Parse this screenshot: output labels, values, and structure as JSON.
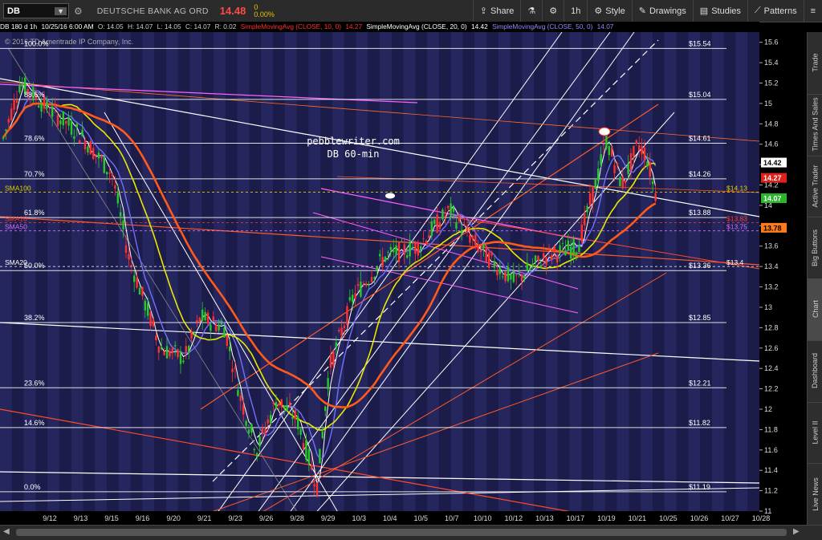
{
  "toolbar": {
    "symbol": "DB",
    "symbol_caret": "▼",
    "company": "DEUTSCHE BANK AG ORD",
    "price": "14.48",
    "change": "0",
    "change_pct": "0.00%",
    "share": "Share",
    "interval": "1h",
    "style": "Style",
    "drawings": "Drawings",
    "studies": "Studies",
    "patterns": "Patterns"
  },
  "studybar": {
    "symbol": "DB 180 d 1h",
    "date": "10/25/16 6:00 AM",
    "open": "O: 14.05",
    "high": "H: 14.07",
    "low": "L: 14.05",
    "close": "C: 14.07",
    "range": "R: 0.02",
    "sma10": "SimpleMovingAvg (CLOSE, 10, 0)",
    "sma10_val": "14.27",
    "sma20": "SimpleMovingAvg (CLOSE, 20, 0)",
    "sma20_val": "14.42",
    "sma50": "SimpleMovingAvg (CLOSE, 50, 0)",
    "sma50_val": "14.07"
  },
  "chart_data": {
    "type": "line",
    "copyright": "© 2016 TD Ameritrade IP Company, Inc.",
    "watermark_line1": "pebblewriter.com",
    "watermark_line2": "DB 60-min",
    "ylim": [
      11.0,
      15.7
    ],
    "yticks": [
      11,
      11.2,
      11.4,
      11.6,
      11.8,
      12,
      12.2,
      12.4,
      12.6,
      12.8,
      13,
      13.2,
      13.4,
      13.6,
      13.8,
      14,
      14.2,
      14.4,
      14.6,
      14.8,
      15,
      15.2,
      15.4,
      15.6
    ],
    "xlabels": [
      "9/12",
      "9/13",
      "9/15",
      "9/16",
      "9/20",
      "9/21",
      "9/23",
      "9/26",
      "9/28",
      "9/29",
      "10/3",
      "10/4",
      "10/5",
      "10/7",
      "10/10",
      "10/12",
      "10/13",
      "10/17",
      "10/19",
      "10/21",
      "10/25",
      "10/26",
      "10/27",
      "10/28"
    ],
    "fib_levels": [
      {
        "pct": "100.0%",
        "price": 15.54,
        "label": "$15.54"
      },
      {
        "pct": "88.6%",
        "price": 15.04,
        "label": "$15.04"
      },
      {
        "pct": "78.6%",
        "price": 14.61,
        "label": "$14.61"
      },
      {
        "pct": "70.7%",
        "price": 14.26,
        "label": "$14.26"
      },
      {
        "pct": "61.8%",
        "price": 13.88,
        "label": "$13.88"
      },
      {
        "pct": "50.0%",
        "price": 13.36,
        "label": "$13.36"
      },
      {
        "pct": "38.2%",
        "price": 12.85,
        "label": "$12.85"
      },
      {
        "pct": "23.6%",
        "price": 12.21,
        "label": "$12.21"
      },
      {
        "pct": "14.6%",
        "price": 11.82,
        "label": "$11.82"
      },
      {
        "pct": "0.0%",
        "price": 11.19,
        "label": "$11.19"
      }
    ],
    "sma_labels": [
      {
        "name": "SMA100",
        "price": 14.13,
        "value_label": "$14.13",
        "color": "#e0d000"
      },
      {
        "name": "SMA10",
        "price": 13.83,
        "value_label": "$13.83",
        "color": "#ff3a2a"
      },
      {
        "name": "SMA50",
        "price": 13.75,
        "value_label": "$13.75",
        "color": "#d070ff"
      },
      {
        "name": "SMA20",
        "price": 13.4,
        "value_label": "$13.4",
        "color": "#ffffff"
      }
    ],
    "price_badges": [
      {
        "label": "14.42",
        "price": 14.42,
        "bg": "#ffffff",
        "fg": "#000000"
      },
      {
        "label": "14.27",
        "price": 14.27,
        "bg": "#e0201a",
        "fg": "#ffffff"
      },
      {
        "label": "14.07",
        "price": 14.07,
        "bg": "#2ab52a",
        "fg": "#ffffff"
      },
      {
        "label": "13.78",
        "price": 13.78,
        "bg": "#ff7a1a",
        "fg": "#000000"
      }
    ],
    "series": [
      {
        "name": "DB",
        "kind": "candles",
        "color_up": "#28c828",
        "color_down": "#ff3030"
      },
      {
        "name": "SMA10",
        "color": "#ffffff"
      },
      {
        "name": "SMA20",
        "color": "#7070ff"
      },
      {
        "name": "SMA50",
        "color": "#e8e800"
      },
      {
        "name": "SMA100",
        "color": "#ff5a1a"
      }
    ],
    "colors": {
      "stripe_a": "#1c1c4a",
      "stripe_b": "#26265e",
      "bg": "#000000"
    }
  },
  "right_tabs": [
    "Trade",
    "Times And Sales",
    "Active Trader",
    "Big Buttons",
    "Chart",
    "Dashboard",
    "Level II",
    "Live News"
  ]
}
